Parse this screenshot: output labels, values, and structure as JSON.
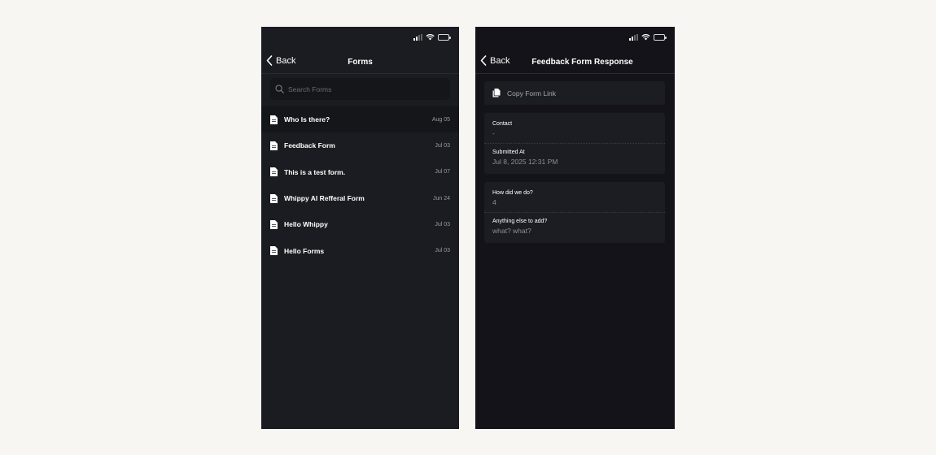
{
  "forms_screen": {
    "back_label": "Back",
    "title": "Forms",
    "search": {
      "placeholder": "Search Forms",
      "value": ""
    },
    "items": [
      {
        "name": "Who Is there?",
        "date": "Aug 05"
      },
      {
        "name": "Feedback Form",
        "date": "Jul 03"
      },
      {
        "name": "This is a test form.",
        "date": "Jul 07"
      },
      {
        "name": "Whippy AI Refferal Form",
        "date": "Jun 24"
      },
      {
        "name": "Hello Whippy",
        "date": "Jul 03"
      },
      {
        "name": "Hello Forms",
        "date": "Jul 03"
      }
    ]
  },
  "response_screen": {
    "back_label": "Back",
    "title": "Feedback Form Response",
    "copy_link_label": "Copy Form Link",
    "contact": {
      "label": "Contact",
      "value": "-"
    },
    "submitted_at": {
      "label": "Submitted At",
      "value": "Jul 8, 2025 12:31 PM"
    },
    "answers": [
      {
        "question": "How did we do?",
        "answer": "4"
      },
      {
        "question": "Anything else to add?",
        "answer": "what? what?"
      }
    ]
  },
  "colors": {
    "background": "#1b1c21",
    "selected_row": "#15161a",
    "battery_fill": "#f3d13a"
  },
  "icons": [
    "signal-icon",
    "wifi-icon",
    "battery-icon",
    "chevron-left-icon",
    "search-icon",
    "document-icon",
    "copy-icon"
  ]
}
